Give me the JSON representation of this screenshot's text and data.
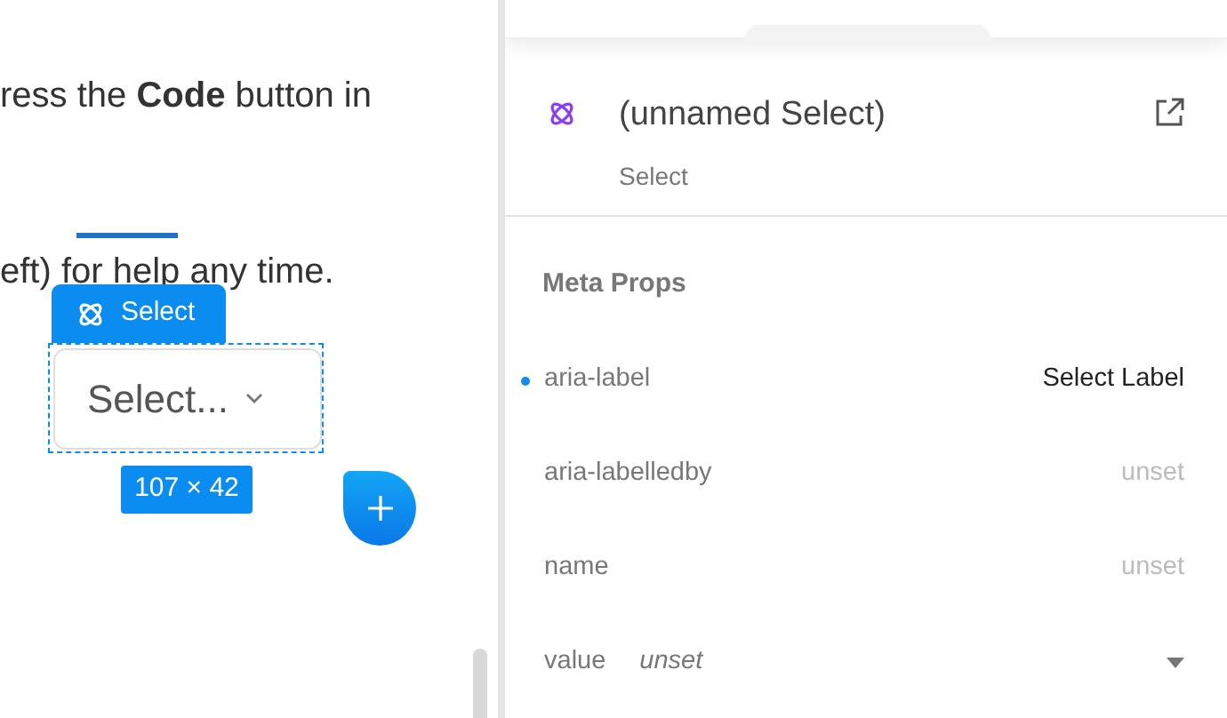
{
  "canvas": {
    "paragraphs": [
      "ress the **Code** button in",
      "eft) for help any time."
    ],
    "selection": {
      "tag": "Select",
      "placeholder": "Select...",
      "size": "107 × 42"
    }
  },
  "inspector": {
    "title": "(unnamed Select)",
    "subtitle": "Select",
    "section": "Meta Props",
    "props": [
      {
        "label": "aria-label",
        "value": "Select Label",
        "set": true,
        "kind": "text"
      },
      {
        "label": "aria-labelledby",
        "value": "unset",
        "set": false,
        "kind": "text"
      },
      {
        "label": "name",
        "value": "unset",
        "set": false,
        "kind": "text"
      },
      {
        "label": "value",
        "value": "unset",
        "set": false,
        "kind": "select"
      }
    ]
  }
}
